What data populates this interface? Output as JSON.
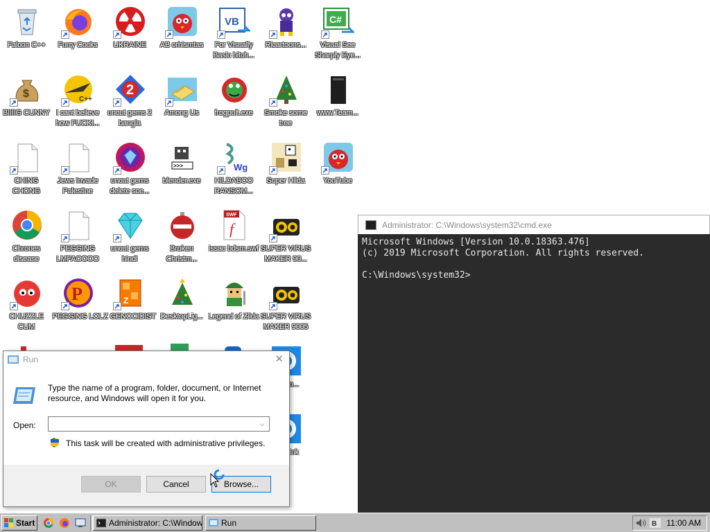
{
  "desktop": {
    "icons": [
      {
        "label": "Falcon C++"
      },
      {
        "label": "Furry Cocks"
      },
      {
        "label": "UKRAINE"
      },
      {
        "label": "AB crhismtas"
      },
      {
        "label": "For Visually Basic bitch..."
      },
      {
        "label": "Ricartoons..."
      },
      {
        "label": "Visual See Sharply Eye..."
      },
      {
        "label": "BIIIIG CUNNY"
      },
      {
        "label": "I cant believe how FUCKI..."
      },
      {
        "label": "uncut gems 2 bangla"
      },
      {
        "label": "Among Us"
      },
      {
        "label": "frogpult.exe"
      },
      {
        "label": "Smoke some tree"
      },
      {
        "label": "www.Team..."
      },
      {
        "label": "CHING CHONG"
      },
      {
        "label": "Jews Invade Palestine"
      },
      {
        "label": "uncut gems delete sce..."
      },
      {
        "label": "blender.exe"
      },
      {
        "label": "HILDABOO RANSOM..."
      },
      {
        "label": "Super Hilda"
      },
      {
        "label": "YouTube"
      },
      {
        "label": "Chrones disease"
      },
      {
        "label": "PEGGING LMFAOOOO"
      },
      {
        "label": "uncut gems hindi"
      },
      {
        "label": "Broken Christm..."
      },
      {
        "label": "issac bdsm.swf"
      },
      {
        "label": "SUPER VIRUS MAKER 90..."
      },
      {
        "label": "CHUZZLE CUM"
      },
      {
        "label": "PEGGING LOL"
      },
      {
        "label": "Z GENOCIDIST"
      },
      {
        "label": "DesktopLig..."
      },
      {
        "label": "Legend of Zilda"
      },
      {
        "label": "SUPER VIRUS MAKER 9005"
      },
      {
        "label": "OS ..o..."
      },
      {
        "label": "OS Link"
      }
    ]
  },
  "cmd": {
    "title": "Administrator: C:\\Windows\\system32\\cmd.exe",
    "line1": "Microsoft Windows [Version 10.0.18363.476]",
    "line2": "(c) 2019 Microsoft Corporation. All rights reserved.",
    "prompt": "C:\\Windows\\system32>"
  },
  "run": {
    "title": "Run",
    "close": "✕",
    "description": "Type the name of a program, folder, document, or Internet resource, and Windows will open it for you.",
    "open_label": "Open:",
    "open_value": "",
    "admin_note": "This task will be created with administrative privileges.",
    "ok": "OK",
    "cancel": "Cancel",
    "browse": "Browse..."
  },
  "taskbar": {
    "start": "Start",
    "tasks": [
      {
        "label": "Administrator: C:\\Windows..."
      },
      {
        "label": "Run"
      }
    ],
    "clock": "11:00 AM"
  }
}
